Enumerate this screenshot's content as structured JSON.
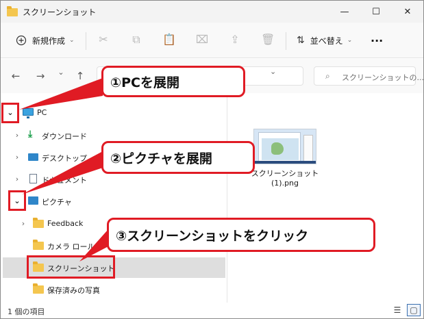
{
  "window": {
    "title": "スクリーンショット",
    "controls": {
      "minimize": "—",
      "maximize": "☐",
      "close": "✕"
    }
  },
  "toolbar": {
    "new_label": "新規作成",
    "new_icon": "plus-circle-icon",
    "sort_label": "並べ替え",
    "more": "···"
  },
  "navigation": {
    "back": "←",
    "forward": "→",
    "history": "⌄",
    "up": "↑",
    "address_expand": "⌄",
    "search_placeholder": "スクリーンショットの..."
  },
  "tree": [
    {
      "label": "PC",
      "icon": "monitor-icon",
      "expanded": true
    },
    {
      "label": "ダウンロード",
      "icon": "download-icon"
    },
    {
      "label": "デスクトップ",
      "icon": "desktop-icon"
    },
    {
      "label": "ドキュメント",
      "icon": "document-icon"
    },
    {
      "label": "ピクチャ",
      "icon": "pictures-icon",
      "expanded": true
    },
    {
      "label": "Feedback",
      "icon": "folder-icon"
    },
    {
      "label": "カメラ ロール",
      "icon": "folder-icon"
    },
    {
      "label": "スクリーンショット",
      "icon": "folder-icon",
      "selected": true
    },
    {
      "label": "保存済みの写真",
      "icon": "folder-icon"
    }
  ],
  "content": {
    "files": [
      {
        "name_line1": "スクリーンショット",
        "name_line2": "(1).png"
      }
    ]
  },
  "status": {
    "item_count": "1 個の項目"
  },
  "annotations": [
    {
      "label": "①PCを展開"
    },
    {
      "label": "②ピクチャを展開"
    },
    {
      "label": "③スクリーンショットをクリック"
    }
  ],
  "colors": {
    "annotation": "#e01b24",
    "folder": "#f4c64f",
    "selection": "#dedede"
  }
}
